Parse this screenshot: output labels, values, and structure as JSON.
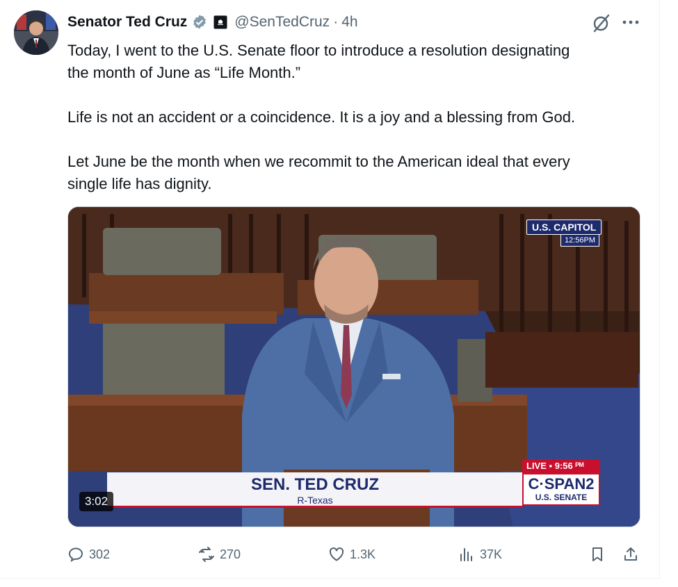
{
  "author": {
    "name": "Senator Ted Cruz",
    "handle": "@SenTedCruz",
    "separator": "·",
    "time": "4h",
    "verified_color": "#829aab"
  },
  "tweet": {
    "paragraphs": [
      "Today, I went to the U.S. Senate floor to introduce a resolution designating\nthe month of June as “Life Month.”",
      "Life is not an accident or a coincidence. It is a joy and a blessing from God.",
      "Let June be the month when we recommit to the American ideal that every\nsingle life has dignity."
    ]
  },
  "video": {
    "duration": "3:02",
    "location_badge": "U.S. CAPITOL",
    "clock": "12:56PM",
    "lower_third_name": "SEN. TED CRUZ",
    "lower_third_sub": "R-Texas",
    "live_label": "LIVE ▪ 9:56 ᴾᴹ",
    "network_logo": "C·SPAN2",
    "network_sub": "U.S. SENATE"
  },
  "actions": {
    "replies": "302",
    "reposts": "270",
    "likes": "1.3K",
    "views": "37K"
  },
  "colors": {
    "text": "#0f1419",
    "secondary": "#536471",
    "cspan_blue": "#1d2a6b",
    "cspan_red": "#c8102e"
  },
  "icons": [
    "verified-badge-icon",
    "government-affiliation-icon",
    "grok-icon",
    "more-icon",
    "reply-icon",
    "repost-icon",
    "like-icon",
    "views-icon",
    "bookmark-icon",
    "share-icon"
  ]
}
